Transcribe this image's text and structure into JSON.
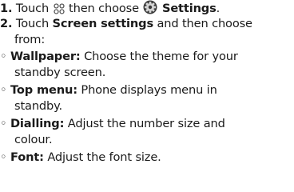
{
  "steps": [
    {
      "number": "1.",
      "pre": "Touch",
      "icon_1": "apps-grid-icon",
      "mid": "then choose",
      "icon_2": "settings-gear-icon",
      "bold": "Settings",
      "end": "."
    },
    {
      "number": "2.",
      "pre": "Touch",
      "bold": "Screen settings",
      "post": "and then choose",
      "cont": "from:"
    }
  ],
  "options": [
    {
      "bullet": "◦",
      "term": "Wallpaper:",
      "line1": "Choose the theme for your",
      "line2": "standby screen."
    },
    {
      "bullet": "◦",
      "term": "Top menu:",
      "line1": "Phone displays menu in",
      "line2": "standby."
    },
    {
      "bullet": "◦",
      "term": "Dialling:",
      "line1": "Adjust the number size and",
      "line2": "colour."
    },
    {
      "bullet": "◦",
      "term": "Font:",
      "line1": "Adjust the font size.",
      "line2": ""
    }
  ]
}
